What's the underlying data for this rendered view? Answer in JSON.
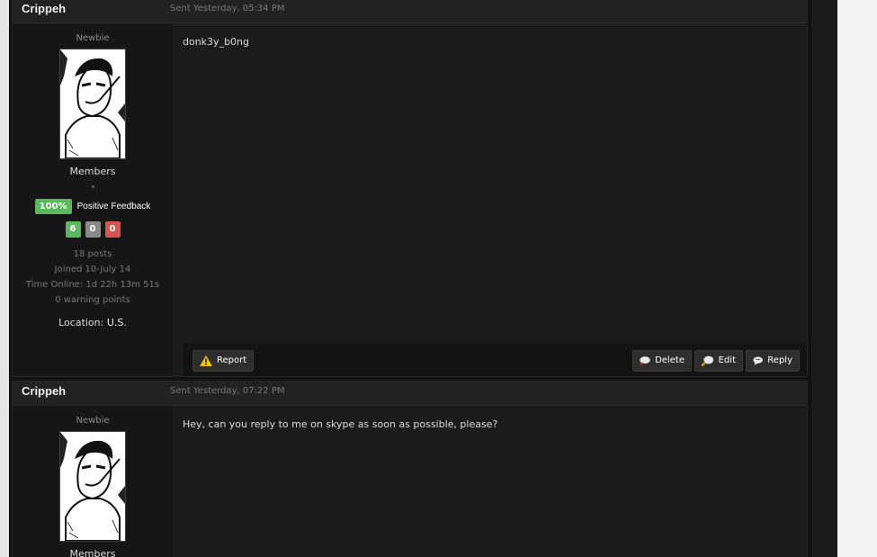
{
  "posts": [
    {
      "author": "Crippeh",
      "date": "Sent Yesterday, 05:34 PM",
      "rank": "Newbie",
      "group": "Members",
      "feedback_pct": "100%",
      "feedback_label": "Positive Feedback",
      "counts": {
        "positive": "6",
        "neutral": "0",
        "negative": "0"
      },
      "posts_count": "18 posts",
      "joined": "Joined 10-July 14",
      "time_online": "Time Online: 1d 22h 13m 51s",
      "warning_points": "0 warning points",
      "location_label": "Location:",
      "location_value": "U.S.",
      "message": "donk3y_b0ng",
      "buttons": {
        "report": "Report",
        "delete": "Delete",
        "edit": "Edit",
        "reply": "Reply"
      }
    },
    {
      "author": "Crippeh",
      "date": "Sent Yesterday, 07:22 PM",
      "rank": "Newbie",
      "group": "Members",
      "message": "Hey, can you reply to me on skype as soon as possible, please?"
    }
  ],
  "icons": {
    "report": "warning-icon",
    "delete": "speech-bubble-icon",
    "edit": "magnifier-icon",
    "reply": "reply-bubble-icon"
  }
}
